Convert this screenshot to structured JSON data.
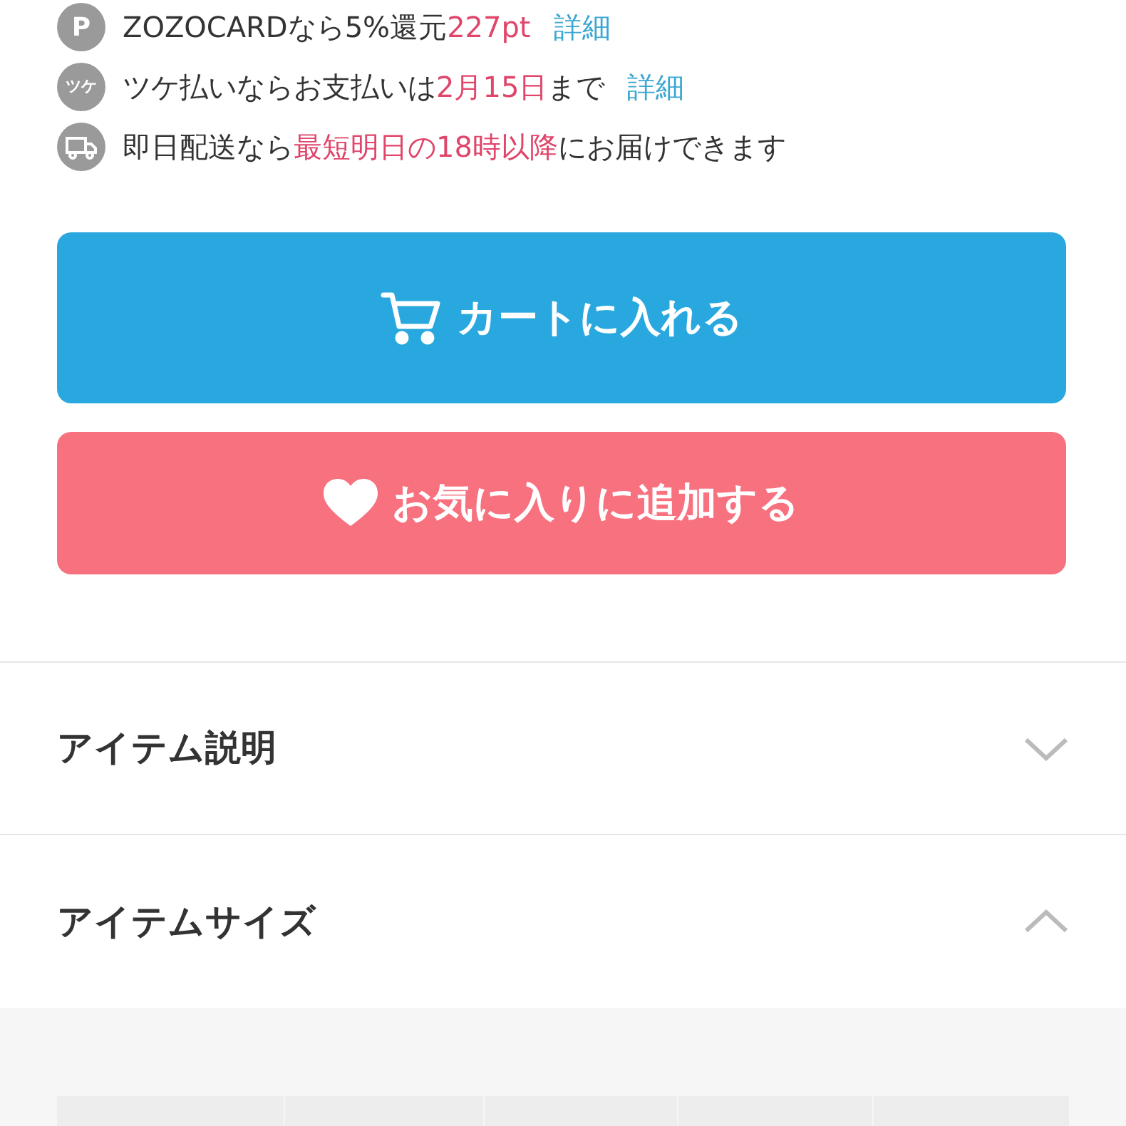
{
  "info_lines": [
    {
      "kind": "points",
      "icon_text": "P",
      "segments": [
        {
          "text": "ZOZOCARDなら5%還元",
          "highlight": false
        },
        {
          "text": "227pt",
          "highlight": true
        }
      ],
      "link": "詳細"
    },
    {
      "kind": "deferred",
      "icon_text": "ツケ",
      "segments": [
        {
          "text": "ツケ払いならお支払いは",
          "highlight": false
        },
        {
          "text": "2月15日",
          "highlight": true
        },
        {
          "text": "まで",
          "highlight": false
        }
      ],
      "link": "詳細"
    },
    {
      "kind": "delivery",
      "segments": [
        {
          "text": "即日配送なら",
          "highlight": false
        },
        {
          "text": "最短明日の18時以降",
          "highlight": true
        },
        {
          "text": "にお届けできます",
          "highlight": false
        }
      ]
    }
  ],
  "buttons": [
    {
      "kind": "cart",
      "label": "カートに入れる"
    },
    {
      "kind": "favorite",
      "label": "お気に入りに追加する"
    }
  ],
  "sections": [
    {
      "title": "アイテム説明",
      "expanded": false
    },
    {
      "title": "アイテムサイズ",
      "expanded": true
    }
  ]
}
